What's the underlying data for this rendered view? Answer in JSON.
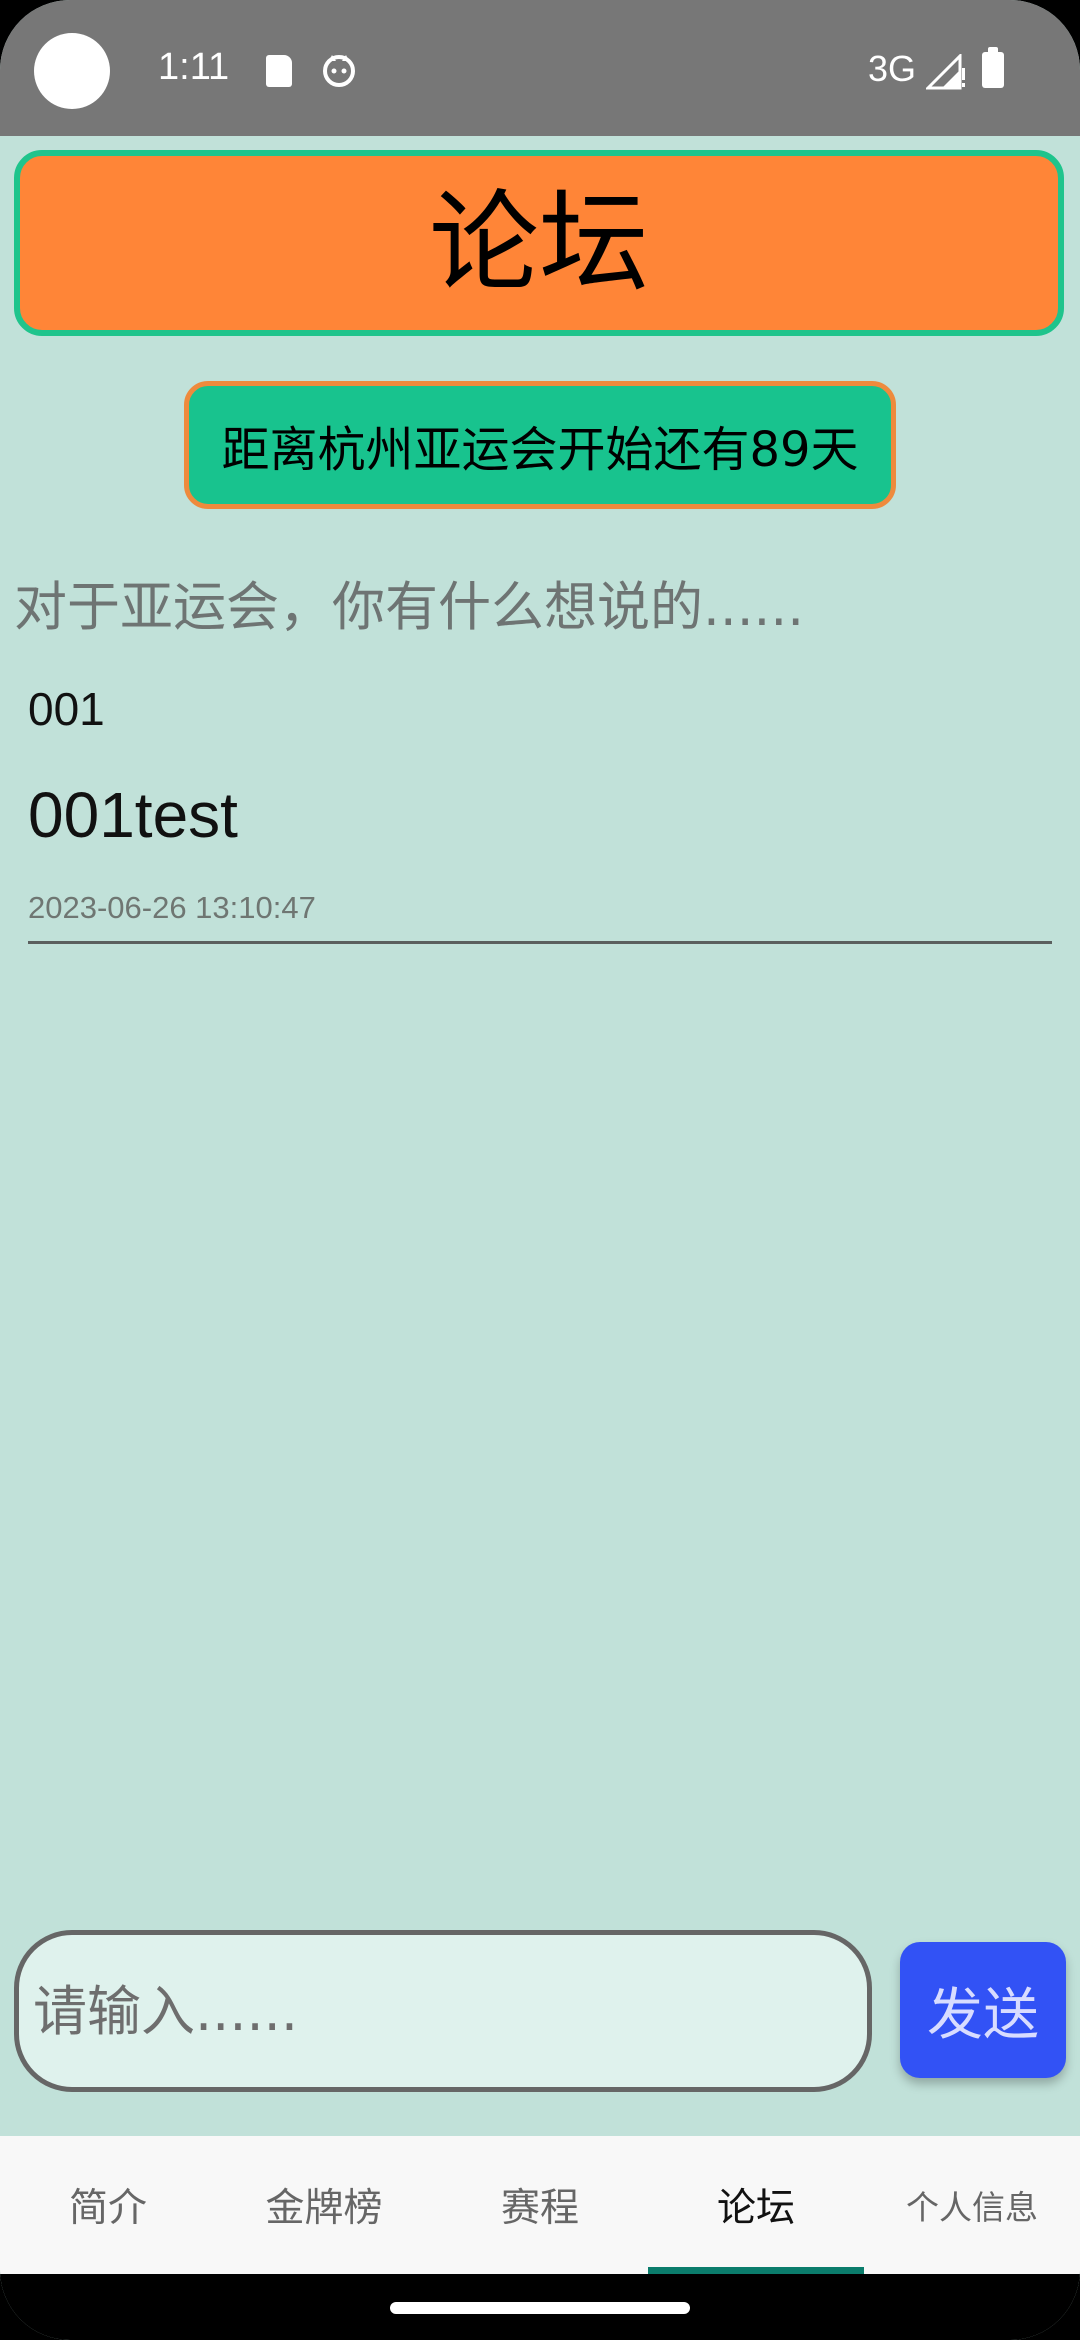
{
  "status_bar": {
    "time": "1:11",
    "network": "3G",
    "icons": [
      "sd-card-icon",
      "cat-face-icon",
      "signal-icon",
      "battery-icon"
    ]
  },
  "header": {
    "title": "论坛"
  },
  "countdown": {
    "text": "距离杭州亚运会开始还有89天"
  },
  "prompt": "对于亚运会，你有什么想说的......",
  "posts": [
    {
      "author": "001",
      "content": "001test",
      "timestamp": "2023-06-26 13:10:47"
    }
  ],
  "composer": {
    "placeholder": "请输入......",
    "send_label": "发送"
  },
  "bottom_nav": {
    "tabs": [
      {
        "label": "简介",
        "active": false
      },
      {
        "label": "金牌榜",
        "active": false
      },
      {
        "label": "赛程",
        "active": false
      },
      {
        "label": "论坛",
        "active": true
      },
      {
        "label": "个人信息",
        "active": false
      }
    ]
  },
  "colors": {
    "background": "#c1e1d9",
    "title_bg": "#ff8537",
    "title_border": "#1fc48c",
    "countdown_bg": "#18c38e",
    "countdown_border": "#ee8a3d",
    "send_button": "#3252f5",
    "active_tab_indicator": "#0b7d6c"
  }
}
